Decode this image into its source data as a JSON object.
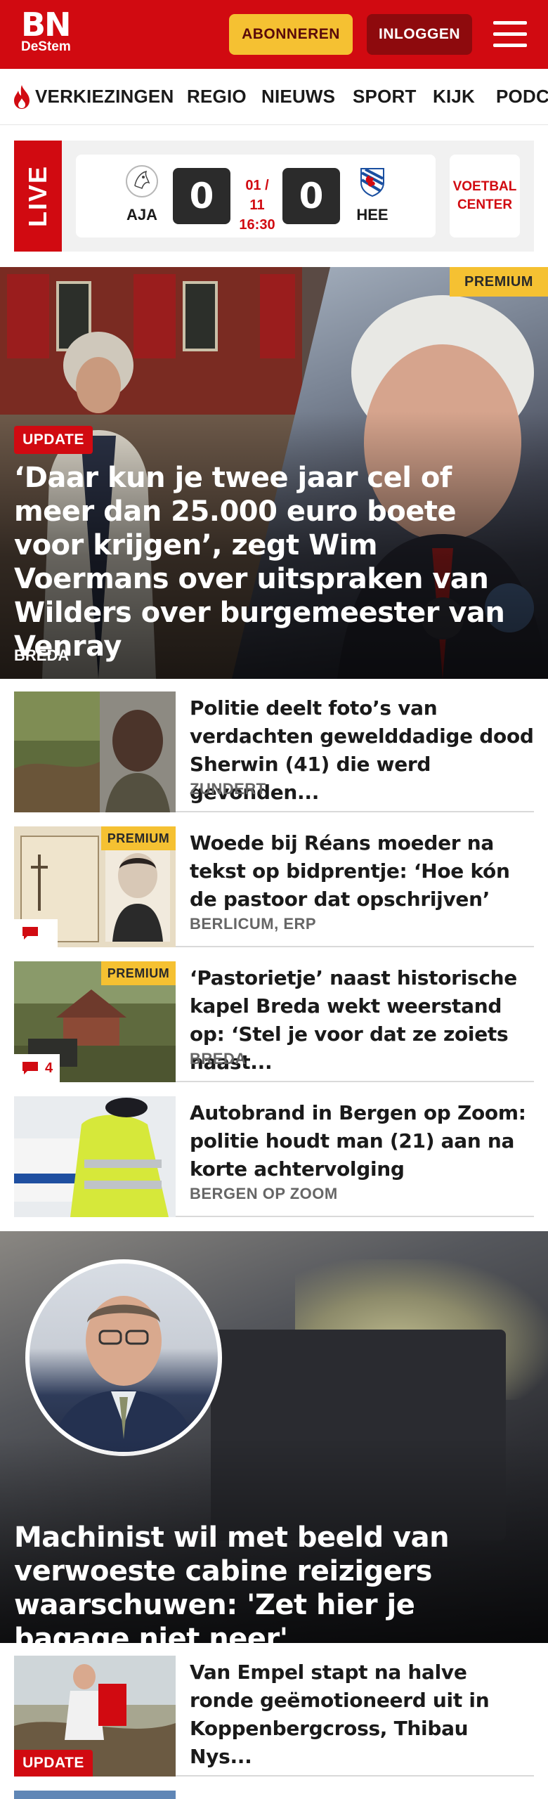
{
  "header": {
    "logo_main": "BN",
    "logo_sub": "DeStem",
    "subscribe_label": "ABONNEREN",
    "login_label": "INLOGGEN",
    "brand_color": "#d10a11",
    "subscribe_color": "#f5c132"
  },
  "nav": {
    "items": [
      {
        "label": "VERKIEZINGEN",
        "icon": "flame-icon"
      },
      {
        "label": "REGIO"
      },
      {
        "label": "NIEUWS"
      },
      {
        "label": "SPORT"
      },
      {
        "label": "KIJK"
      },
      {
        "label": "PODC"
      }
    ]
  },
  "live": {
    "tag": "LIVE",
    "home_team": "AJA",
    "away_team": "HEE",
    "home_score": "0",
    "away_score": "0",
    "date": "01 / 11",
    "time": "16:30",
    "center_line1": "VOETBAL",
    "center_line2": "CENTER"
  },
  "hero": {
    "premium": "PREMIUM",
    "update": "UPDATE",
    "title": "‘Daar kun je twee jaar cel of meer dan 25.000 euro boete voor krijgen’, zegt Wim Voermans over uitspraken van Wilders over burgemeester van Venray",
    "location": "BREDA"
  },
  "articles": [
    {
      "title": "Politie deelt foto’s van verdachten gewelddadige dood Sherwin (41) die werd gevonden...",
      "location": "ZUNDERT"
    },
    {
      "premium": "PREMIUM",
      "title": "Woede bij Réans moeder na tekst op bidprentje: ‘Hoe kón de pastoor dat opschrijven’",
      "location": "BERLICUM, ERP"
    },
    {
      "premium": "PREMIUM",
      "comments": "4",
      "title": "‘Pastorietje’ naast historische kapel Breda wekt weerstand op: ‘Stel je voor dat ze zoiets naast...",
      "location": "BREDA"
    },
    {
      "title": "Autobrand in Bergen op Zoom: politie houdt man (21) aan na korte achtervolging",
      "location": "BERGEN OP ZOOM"
    }
  ],
  "feature": {
    "title": "Machinist wil met beeld van verwoeste cabine reizigers waarschu­wen: 'Zet hier je bagage niet neer'"
  },
  "article_bottom": {
    "update": "UPDATE",
    "title": "Van Empel stapt na halve ronde geëmotioneerd uit in Koppenbergcross, Thibau Nys..."
  }
}
